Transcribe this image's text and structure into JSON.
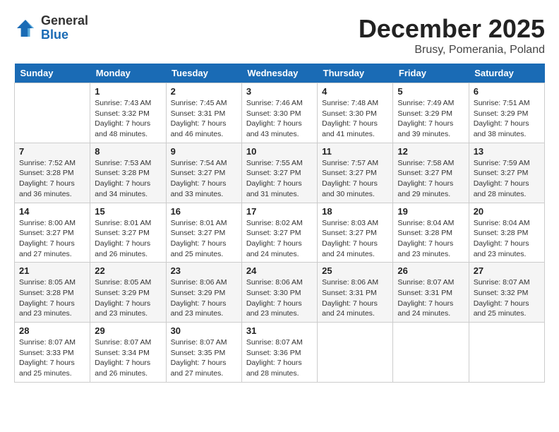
{
  "header": {
    "logo_general": "General",
    "logo_blue": "Blue",
    "month_title": "December 2025",
    "location": "Brusy, Pomerania, Poland"
  },
  "days_of_week": [
    "Sunday",
    "Monday",
    "Tuesday",
    "Wednesday",
    "Thursday",
    "Friday",
    "Saturday"
  ],
  "weeks": [
    [
      {
        "day": "",
        "info": ""
      },
      {
        "day": "1",
        "info": "Sunrise: 7:43 AM\nSunset: 3:32 PM\nDaylight: 7 hours\nand 48 minutes."
      },
      {
        "day": "2",
        "info": "Sunrise: 7:45 AM\nSunset: 3:31 PM\nDaylight: 7 hours\nand 46 minutes."
      },
      {
        "day": "3",
        "info": "Sunrise: 7:46 AM\nSunset: 3:30 PM\nDaylight: 7 hours\nand 43 minutes."
      },
      {
        "day": "4",
        "info": "Sunrise: 7:48 AM\nSunset: 3:30 PM\nDaylight: 7 hours\nand 41 minutes."
      },
      {
        "day": "5",
        "info": "Sunrise: 7:49 AM\nSunset: 3:29 PM\nDaylight: 7 hours\nand 39 minutes."
      },
      {
        "day": "6",
        "info": "Sunrise: 7:51 AM\nSunset: 3:29 PM\nDaylight: 7 hours\nand 38 minutes."
      }
    ],
    [
      {
        "day": "7",
        "info": "Sunrise: 7:52 AM\nSunset: 3:28 PM\nDaylight: 7 hours\nand 36 minutes."
      },
      {
        "day": "8",
        "info": "Sunrise: 7:53 AM\nSunset: 3:28 PM\nDaylight: 7 hours\nand 34 minutes."
      },
      {
        "day": "9",
        "info": "Sunrise: 7:54 AM\nSunset: 3:27 PM\nDaylight: 7 hours\nand 33 minutes."
      },
      {
        "day": "10",
        "info": "Sunrise: 7:55 AM\nSunset: 3:27 PM\nDaylight: 7 hours\nand 31 minutes."
      },
      {
        "day": "11",
        "info": "Sunrise: 7:57 AM\nSunset: 3:27 PM\nDaylight: 7 hours\nand 30 minutes."
      },
      {
        "day": "12",
        "info": "Sunrise: 7:58 AM\nSunset: 3:27 PM\nDaylight: 7 hours\nand 29 minutes."
      },
      {
        "day": "13",
        "info": "Sunrise: 7:59 AM\nSunset: 3:27 PM\nDaylight: 7 hours\nand 28 minutes."
      }
    ],
    [
      {
        "day": "14",
        "info": "Sunrise: 8:00 AM\nSunset: 3:27 PM\nDaylight: 7 hours\nand 27 minutes."
      },
      {
        "day": "15",
        "info": "Sunrise: 8:01 AM\nSunset: 3:27 PM\nDaylight: 7 hours\nand 26 minutes."
      },
      {
        "day": "16",
        "info": "Sunrise: 8:01 AM\nSunset: 3:27 PM\nDaylight: 7 hours\nand 25 minutes."
      },
      {
        "day": "17",
        "info": "Sunrise: 8:02 AM\nSunset: 3:27 PM\nDaylight: 7 hours\nand 24 minutes."
      },
      {
        "day": "18",
        "info": "Sunrise: 8:03 AM\nSunset: 3:27 PM\nDaylight: 7 hours\nand 24 minutes."
      },
      {
        "day": "19",
        "info": "Sunrise: 8:04 AM\nSunset: 3:28 PM\nDaylight: 7 hours\nand 23 minutes."
      },
      {
        "day": "20",
        "info": "Sunrise: 8:04 AM\nSunset: 3:28 PM\nDaylight: 7 hours\nand 23 minutes."
      }
    ],
    [
      {
        "day": "21",
        "info": "Sunrise: 8:05 AM\nSunset: 3:28 PM\nDaylight: 7 hours\nand 23 minutes."
      },
      {
        "day": "22",
        "info": "Sunrise: 8:05 AM\nSunset: 3:29 PM\nDaylight: 7 hours\nand 23 minutes."
      },
      {
        "day": "23",
        "info": "Sunrise: 8:06 AM\nSunset: 3:29 PM\nDaylight: 7 hours\nand 23 minutes."
      },
      {
        "day": "24",
        "info": "Sunrise: 8:06 AM\nSunset: 3:30 PM\nDaylight: 7 hours\nand 23 minutes."
      },
      {
        "day": "25",
        "info": "Sunrise: 8:06 AM\nSunset: 3:31 PM\nDaylight: 7 hours\nand 24 minutes."
      },
      {
        "day": "26",
        "info": "Sunrise: 8:07 AM\nSunset: 3:31 PM\nDaylight: 7 hours\nand 24 minutes."
      },
      {
        "day": "27",
        "info": "Sunrise: 8:07 AM\nSunset: 3:32 PM\nDaylight: 7 hours\nand 25 minutes."
      }
    ],
    [
      {
        "day": "28",
        "info": "Sunrise: 8:07 AM\nSunset: 3:33 PM\nDaylight: 7 hours\nand 25 minutes."
      },
      {
        "day": "29",
        "info": "Sunrise: 8:07 AM\nSunset: 3:34 PM\nDaylight: 7 hours\nand 26 minutes."
      },
      {
        "day": "30",
        "info": "Sunrise: 8:07 AM\nSunset: 3:35 PM\nDaylight: 7 hours\nand 27 minutes."
      },
      {
        "day": "31",
        "info": "Sunrise: 8:07 AM\nSunset: 3:36 PM\nDaylight: 7 hours\nand 28 minutes."
      },
      {
        "day": "",
        "info": ""
      },
      {
        "day": "",
        "info": ""
      },
      {
        "day": "",
        "info": ""
      }
    ]
  ]
}
